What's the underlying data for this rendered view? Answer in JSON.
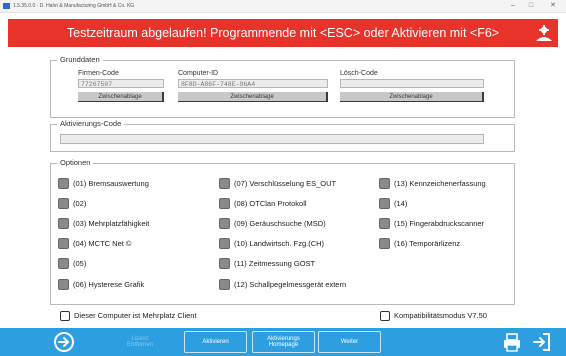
{
  "window": {
    "title": "1.5.35.0.0 · D. Hahn & Manufacturing GmbH & Co. KG",
    "minimize": "–",
    "maximize": "□",
    "close": "✕"
  },
  "banner": {
    "message": "Testzeitraum abgelaufen! Programmende mit <ESC> oder Aktivieren mit <F6>",
    "brand_color": "#e8332b"
  },
  "grunddaten": {
    "legend": "Grunddaten",
    "firmen_code": {
      "label": "Firmen-Code",
      "value": "77267507"
    },
    "computer_id": {
      "label": "Computer-ID",
      "value": "8F8D-A86F-748E-96A4"
    },
    "loesch_code": {
      "label": "Lösch-Code",
      "value": ""
    },
    "clipboard_label": "Zwischenablage"
  },
  "aktivierung": {
    "legend": "Aktivierungs-Code",
    "value": ""
  },
  "optionen": {
    "legend": "Optionen",
    "col1": [
      "(01) Bremsauswertung",
      "(02)",
      "(03) Mehrplatzfähigkeit",
      "(04) MCTC Net ©",
      "(05)",
      "(06) Hysterese Grafik"
    ],
    "col2": [
      "(07) Verschlüsselung ES_OUT",
      "(08) OTClan Protokoll",
      "(09) Geräuschsuche (MSD)",
      "(10) Landwirtsch. Fzg.(CH)",
      "(11) Zeitmessung GOST",
      "(12) Schallpegelmessgerät extern"
    ],
    "col3": [
      "(13) Kennzeichenerfassung",
      "(14)",
      "(15) Fingerabdruckscanner",
      "(16) Temporärlizenz"
    ]
  },
  "footer_checks": {
    "mehrplatz": "Dieser Computer ist Mehrplatz Client",
    "kompat": "Kompatibilitätsmodus V7.50"
  },
  "bottombar": {
    "color": "#2d9ee0",
    "lizenz_entfernen": "Lizenz Entfernen",
    "aktivieren": "Aktivieren",
    "aktivierungs_homepage": "Aktivierungs Homepage",
    "weiter": "Weiter"
  }
}
